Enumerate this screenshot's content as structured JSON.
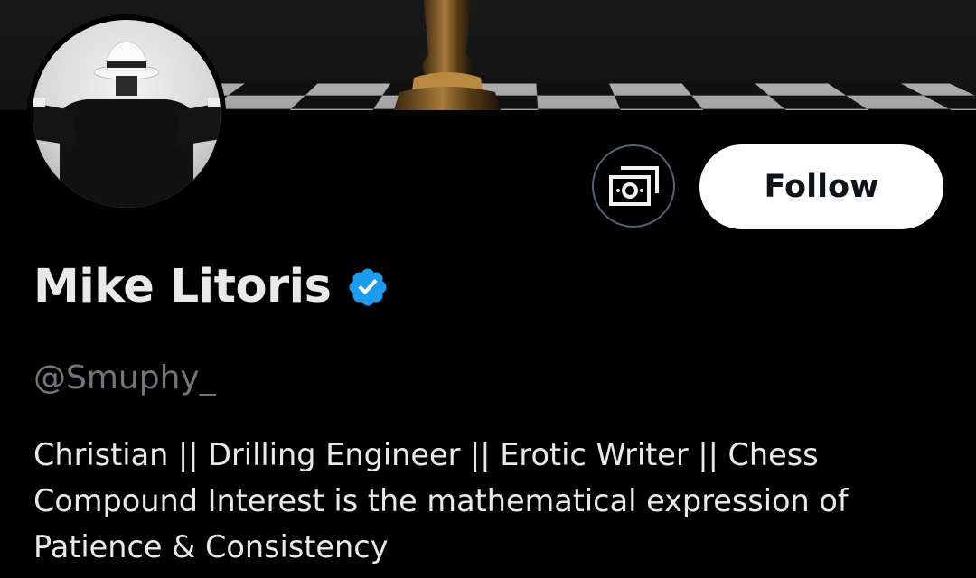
{
  "profile": {
    "display_name": "Mike Litoris",
    "handle": "@Smuphy_",
    "verified": true,
    "verified_color": "#1d9bf0",
    "bio_lines": [
      "Christian || Drilling Engineer || Erotic Writer || Chess",
      "Compound Interest is the mathematical expression of",
      "Patience & Consistency"
    ]
  },
  "actions": {
    "follow_label": "Follow",
    "subscribe_icon": "money-icon"
  },
  "banner": {
    "image": "chessboard with dark pawn"
  },
  "avatar": {
    "image": "man in white fedora, black and white"
  },
  "colors": {
    "background": "#000000",
    "text_primary": "#e7e9ea",
    "text_secondary": "#71767b",
    "follow_bg": "#ffffff",
    "follow_text": "#0f1419",
    "outline": "#536471"
  }
}
